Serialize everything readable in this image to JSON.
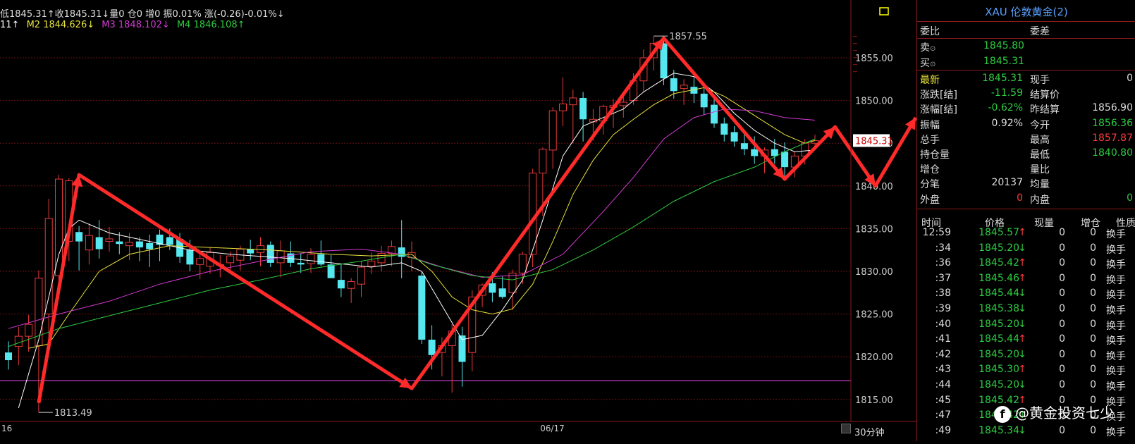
{
  "legend": {
    "line1": "低1845.31↑收1845.31↓量0 仓0 增0 振0.01% 涨(-0.26)-0.01%↓",
    "m1": "11↑",
    "m2": "M2 1844.626↓",
    "m3": "M3 1848.102↓",
    "m4": "M4 1846.108↑"
  },
  "colors": {
    "up": "#e83a3a",
    "down": "#56e8f0",
    "m1": "#ffffff",
    "m2": "#e8e23a",
    "m3": "#d33ad3",
    "m4": "#2ecc40",
    "grid": "#6b1010",
    "support": "#c03ac0",
    "arrow": "#ff2a2a"
  },
  "chart_data": {
    "type": "candlestick",
    "ylim": [
      1813,
      1858
    ],
    "yticks": [
      "1855.00",
      "1850.00",
      "1845.00",
      "1840.00",
      "1835.00",
      "1830.00",
      "1825.00",
      "1820.00",
      "1815.00"
    ],
    "ytick_values": [
      1855,
      1850,
      1845,
      1840,
      1835,
      1830,
      1825,
      1820,
      1815
    ],
    "x_labels": [
      {
        "label": "16",
        "i": 0
      },
      {
        "label": "06/17",
        "i": 54
      }
    ],
    "current_price_label": "1845.31",
    "current_price": 1845.31,
    "support_level": 1817.2,
    "annotations": [
      {
        "label": "1857.55",
        "value": 1857.55,
        "i": 64
      },
      {
        "label": "1813.49",
        "value": 1813.49,
        "i": 3
      }
    ],
    "candles": [
      [
        1820.5,
        1821.8,
        1818.5,
        1819.6
      ],
      [
        1821.2,
        1823.5,
        1819.0,
        1822.4
      ],
      [
        1822.4,
        1824.9,
        1820.6,
        1823.8
      ],
      [
        1821.3,
        1830.1,
        1813.5,
        1829.2
      ],
      [
        1825.0,
        1838.5,
        1821.5,
        1836.2
      ],
      [
        1829.5,
        1841.3,
        1826.8,
        1840.8
      ],
      [
        1833.5,
        1840.9,
        1831.2,
        1840.6
      ],
      [
        1834.6,
        1835.3,
        1830.1,
        1833.5
      ],
      [
        1832.5,
        1835.6,
        1830.8,
        1834.2
      ],
      [
        1834.0,
        1836.0,
        1831.5,
        1832.6
      ],
      [
        1833.5,
        1835.2,
        1832.3,
        1833.8
      ],
      [
        1833.5,
        1834.6,
        1832.0,
        1833.2
      ],
      [
        1833.0,
        1834.5,
        1831.3,
        1833.4
      ],
      [
        1833.5,
        1834.0,
        1831.2,
        1832.8
      ],
      [
        1833.3,
        1834.3,
        1830.5,
        1832.6
      ],
      [
        1834.3,
        1834.9,
        1831.2,
        1833.1
      ],
      [
        1834.0,
        1835.0,
        1832.5,
        1833.1
      ],
      [
        1833.8,
        1834.5,
        1831.0,
        1831.7
      ],
      [
        1832.5,
        1833.7,
        1830.0,
        1830.8
      ],
      [
        1830.8,
        1832.0,
        1829.1,
        1831.5
      ],
      [
        1830.6,
        1832.8,
        1829.7,
        1832.2
      ],
      [
        1830.7,
        1831.9,
        1829.3,
        1830.8
      ],
      [
        1831.0,
        1832.3,
        1829.8,
        1831.8
      ],
      [
        1831.3,
        1833.0,
        1830.1,
        1832.6
      ],
      [
        1832.6,
        1833.7,
        1831.3,
        1832.1
      ],
      [
        1832.2,
        1834.0,
        1830.6,
        1833.0
      ],
      [
        1833.1,
        1833.5,
        1830.5,
        1831.0
      ],
      [
        1831.0,
        1833.6,
        1829.3,
        1832.4
      ],
      [
        1832.1,
        1833.5,
        1830.5,
        1831.0
      ],
      [
        1831.0,
        1832.1,
        1829.8,
        1830.8
      ],
      [
        1830.9,
        1832.7,
        1829.8,
        1832.0
      ],
      [
        1832.0,
        1833.6,
        1830.6,
        1830.8
      ],
      [
        1830.8,
        1831.9,
        1829.7,
        1829.2
      ],
      [
        1829.0,
        1830.8,
        1827.0,
        1828.0
      ],
      [
        1828.0,
        1829.2,
        1826.3,
        1828.8
      ],
      [
        1828.5,
        1831.2,
        1827.0,
        1830.5
      ],
      [
        1830.6,
        1832.2,
        1829.7,
        1831.2
      ],
      [
        1831.0,
        1833.0,
        1830.0,
        1832.1
      ],
      [
        1832.1,
        1833.6,
        1830.6,
        1832.9
      ],
      [
        1832.8,
        1836.0,
        1829.2,
        1831.7
      ],
      [
        1831.6,
        1833.5,
        1830.0,
        1832.2
      ],
      [
        1829.5,
        1830.0,
        1821.5,
        1822.0
      ],
      [
        1822.0,
        1823.7,
        1818.5,
        1820.2
      ],
      [
        1820.5,
        1822.3,
        1817.7,
        1821.3
      ],
      [
        1821.3,
        1823.8,
        1815.8,
        1823.0
      ],
      [
        1822.5,
        1823.5,
        1816.5,
        1819.4
      ],
      [
        1820.5,
        1827.8,
        1818.3,
        1827.0
      ],
      [
        1827.2,
        1828.6,
        1825.8,
        1828.4
      ],
      [
        1828.6,
        1829.9,
        1826.4,
        1827.5
      ],
      [
        1828.0,
        1829.4,
        1826.8,
        1827.0
      ],
      [
        1827.5,
        1830.2,
        1825.5,
        1829.8
      ],
      [
        1829.8,
        1832.3,
        1828.5,
        1832.0
      ],
      [
        1832.0,
        1842.0,
        1830.5,
        1841.5
      ],
      [
        1841.5,
        1844.5,
        1836.5,
        1844.3
      ],
      [
        1844.2,
        1849.2,
        1842.0,
        1848.8
      ],
      [
        1848.8,
        1852.7,
        1847.0,
        1849.6
      ],
      [
        1849.5,
        1851.3,
        1845.0,
        1850.3
      ],
      [
        1850.3,
        1851.0,
        1845.2,
        1847.8
      ],
      [
        1847.5,
        1849.0,
        1845.3,
        1847.8
      ],
      [
        1847.6,
        1849.5,
        1846.0,
        1849.3
      ],
      [
        1849.2,
        1850.2,
        1846.8,
        1849.4
      ],
      [
        1849.4,
        1850.8,
        1848.0,
        1849.8
      ],
      [
        1850.0,
        1853.2,
        1849.5,
        1852.3
      ],
      [
        1852.3,
        1856.0,
        1851.0,
        1855.0
      ],
      [
        1855.0,
        1857.5,
        1853.5,
        1856.7
      ],
      [
        1856.7,
        1857.5,
        1851.8,
        1852.6
      ],
      [
        1852.6,
        1853.6,
        1850.2,
        1851.1
      ],
      [
        1851.4,
        1852.5,
        1849.5,
        1851.8
      ],
      [
        1851.6,
        1852.7,
        1849.7,
        1850.8
      ],
      [
        1850.8,
        1851.6,
        1848.3,
        1849.2
      ],
      [
        1849.5,
        1850.3,
        1846.8,
        1847.3
      ],
      [
        1847.3,
        1848.0,
        1845.2,
        1846.0
      ],
      [
        1846.3,
        1847.0,
        1844.6,
        1845.2
      ],
      [
        1845.0,
        1846.2,
        1843.6,
        1844.3
      ],
      [
        1844.3,
        1845.8,
        1842.6,
        1843.5
      ],
      [
        1843.5,
        1844.5,
        1841.5,
        1844.2
      ],
      [
        1844.3,
        1845.5,
        1842.6,
        1843.5
      ],
      [
        1844.0,
        1845.1,
        1841.0,
        1842.2
      ],
      [
        1842.2,
        1844.0,
        1841.0,
        1843.5
      ],
      [
        1843.5,
        1845.5,
        1842.5,
        1845.0
      ],
      [
        1845.0,
        1846.0,
        1844.2,
        1845.3
      ]
    ],
    "mas": [
      {
        "name": "M1",
        "color_key": "m1",
        "points": [
          [
            1,
            1814.0
          ],
          [
            3,
            1822.0
          ],
          [
            5,
            1832.0
          ],
          [
            6,
            1835.0
          ],
          [
            7,
            1836.0
          ],
          [
            10,
            1834.5
          ],
          [
            14,
            1833.5
          ],
          [
            18,
            1832.5
          ],
          [
            22,
            1832.0
          ],
          [
            28,
            1831.5
          ],
          [
            32,
            1831.0
          ],
          [
            36,
            1830.5
          ],
          [
            39,
            1831.0
          ],
          [
            41,
            1830.0
          ],
          [
            43,
            1826.0
          ],
          [
            45,
            1822.0
          ],
          [
            47,
            1822.5
          ],
          [
            49,
            1825.5
          ],
          [
            51,
            1829.0
          ],
          [
            53,
            1836.0
          ],
          [
            55,
            1843.5
          ],
          [
            57,
            1847.0
          ],
          [
            59,
            1848.0
          ],
          [
            61,
            1849.0
          ],
          [
            63,
            1851.0
          ],
          [
            65,
            1852.5
          ],
          [
            66,
            1853.2
          ],
          [
            68,
            1852.8
          ],
          [
            70,
            1851.0
          ],
          [
            72,
            1848.5
          ],
          [
            74,
            1846.5
          ],
          [
            76,
            1845.0
          ],
          [
            78,
            1844.0
          ],
          [
            80,
            1844.2
          ]
        ]
      },
      {
        "name": "M2",
        "color_key": "m2",
        "points": [
          [
            2,
            1821.0
          ],
          [
            4,
            1821.5
          ],
          [
            6,
            1825.0
          ],
          [
            9,
            1830.0
          ],
          [
            12,
            1832.0
          ],
          [
            16,
            1833.0
          ],
          [
            20,
            1832.8
          ],
          [
            26,
            1832.5
          ],
          [
            32,
            1832.0
          ],
          [
            36,
            1831.8
          ],
          [
            40,
            1832.0
          ],
          [
            42,
            1830.0
          ],
          [
            44,
            1827.0
          ],
          [
            46,
            1825.5
          ],
          [
            48,
            1825.0
          ],
          [
            50,
            1825.6
          ],
          [
            52,
            1828.5
          ],
          [
            54,
            1833.5
          ],
          [
            56,
            1839.0
          ],
          [
            58,
            1843.0
          ],
          [
            60,
            1846.0
          ],
          [
            62,
            1847.8
          ],
          [
            64,
            1849.5
          ],
          [
            66,
            1850.8
          ],
          [
            69,
            1851.5
          ],
          [
            71,
            1850.5
          ],
          [
            73,
            1849.0
          ],
          [
            75,
            1847.5
          ],
          [
            77,
            1846.0
          ],
          [
            79,
            1845.0
          ],
          [
            80,
            1845.3
          ]
        ]
      },
      {
        "name": "M3",
        "color_key": "m3",
        "points": [
          [
            0,
            1823.3
          ],
          [
            5,
            1825.0
          ],
          [
            10,
            1826.5
          ],
          [
            15,
            1828.5
          ],
          [
            20,
            1830.0
          ],
          [
            25,
            1831.2
          ],
          [
            30,
            1832.3
          ],
          [
            35,
            1832.6
          ],
          [
            39,
            1832.0
          ],
          [
            43,
            1830.5
          ],
          [
            47,
            1829.3
          ],
          [
            51,
            1829.6
          ],
          [
            55,
            1832.0
          ],
          [
            59,
            1837.0
          ],
          [
            62,
            1841.0
          ],
          [
            65,
            1845.5
          ],
          [
            68,
            1848.0
          ],
          [
            71,
            1849.0
          ],
          [
            74,
            1848.8
          ],
          [
            77,
            1848.0
          ],
          [
            80,
            1847.7
          ]
        ]
      },
      {
        "name": "M4",
        "color_key": "m4",
        "points": [
          [
            0,
            1821.2
          ],
          [
            5,
            1823.3
          ],
          [
            10,
            1824.8
          ],
          [
            15,
            1826.3
          ],
          [
            20,
            1827.8
          ],
          [
            25,
            1829.0
          ],
          [
            30,
            1830.3
          ],
          [
            35,
            1831.2
          ],
          [
            39,
            1832.0
          ],
          [
            42,
            1830.8
          ],
          [
            46,
            1829.5
          ],
          [
            50,
            1829.0
          ],
          [
            54,
            1830.2
          ],
          [
            58,
            1832.5
          ],
          [
            62,
            1835.2
          ],
          [
            66,
            1838.2
          ],
          [
            70,
            1840.5
          ],
          [
            74,
            1842.2
          ],
          [
            77,
            1844.0
          ],
          [
            80,
            1845.5
          ]
        ]
      }
    ]
  },
  "panel": {
    "title": "XAU 伦敦黄金(2)",
    "weibi_label": "委比",
    "weicha_label": "委差",
    "sell_label": "卖",
    "sell_value": "1845.80",
    "buy_label": "买",
    "buy_value": "1845.31",
    "stats": [
      {
        "l1": "最新",
        "v1": "1845.31",
        "c1": "#2ecc40",
        "l2": "现手",
        "v2": "0",
        "c2": "#ddd"
      },
      {
        "l1": "涨跌[结]",
        "v1": "-11.59",
        "c1": "#2ecc40",
        "l2": "结算价",
        "v2": "",
        "c2": "#ddd"
      },
      {
        "l1": "涨幅[结]",
        "v1": "-0.62%",
        "c1": "#2ecc40",
        "l2": "昨结算",
        "v2": "1856.90",
        "c2": "#ddd"
      },
      {
        "l1": "振幅",
        "v1": "0.92%",
        "c1": "#ddd",
        "l2": "今开",
        "v2": "1856.36",
        "c2": "#2ecc40"
      },
      {
        "l1": "总手",
        "v1": "",
        "c1": "#ddd",
        "l2": "最高",
        "v2": "1857.87",
        "c2": "#ff3a3a"
      },
      {
        "l1": "持仓量",
        "v1": "",
        "c1": "#ddd",
        "l2": "最低",
        "v2": "1840.80",
        "c2": "#2ecc40"
      },
      {
        "l1": "增仓",
        "v1": "",
        "c1": "#ddd",
        "l2": "量比",
        "v2": "",
        "c2": "#ddd"
      },
      {
        "l1": "分笔",
        "v1": "20137",
        "c1": "#ddd",
        "l2": "均量",
        "v2": "",
        "c2": "#ddd"
      },
      {
        "l1": "外盘",
        "v1": "0",
        "c1": "#ff3a3a",
        "l2": "内盘",
        "v2": "0",
        "c2": "#2ecc40"
      }
    ],
    "tick_headers": [
      "时间",
      "价格",
      "现量",
      "增仓",
      "性质"
    ],
    "ticks": [
      {
        "t": "12:59",
        "p": "1845.57",
        "d": "↑",
        "q": "0",
        "z": "0",
        "x": "换手"
      },
      {
        "t": ":34",
        "p": "1845.20",
        "d": "↓",
        "q": "0",
        "z": "0",
        "x": "换手"
      },
      {
        "t": ":36",
        "p": "1845.42",
        "d": "↑",
        "q": "0",
        "z": "0",
        "x": "换手"
      },
      {
        "t": ":37",
        "p": "1845.46",
        "d": "↑",
        "q": "0",
        "z": "0",
        "x": "换手"
      },
      {
        "t": ":38",
        "p": "1845.44",
        "d": "↓",
        "q": "0",
        "z": "0",
        "x": "换手"
      },
      {
        "t": ":39",
        "p": "1845.38",
        "d": "↓",
        "q": "0",
        "z": "0",
        "x": "换手"
      },
      {
        "t": ":40",
        "p": "1845.20",
        "d": "↓",
        "q": "0",
        "z": "0",
        "x": "换手"
      },
      {
        "t": ":41",
        "p": "1845.44",
        "d": "↑",
        "q": "0",
        "z": "0",
        "x": "换手"
      },
      {
        "t": ":42",
        "p": "1845.20",
        "d": "↓",
        "q": "0",
        "z": "0",
        "x": "换手"
      },
      {
        "t": ":43",
        "p": "1845.30",
        "d": "↑",
        "q": "0",
        "z": "0",
        "x": "换手"
      },
      {
        "t": ":44",
        "p": "1845.20",
        "d": "↓",
        "q": "0",
        "z": "0",
        "x": "换手"
      },
      {
        "t": ":45",
        "p": "1845.42",
        "d": "↑",
        "q": "0",
        "z": "0",
        "x": "换手"
      },
      {
        "t": ":47",
        "p": "1845.42",
        "d": "↓",
        "q": "0",
        "z": "0",
        "x": "换手"
      },
      {
        "t": ":49",
        "p": "1845.34",
        "d": "↓",
        "q": "0",
        "z": "0",
        "x": "换手"
      }
    ]
  },
  "bottom": {
    "period": "30分钟"
  },
  "watermark": {
    "icon": "f",
    "text": "@黄金投资七少"
  }
}
